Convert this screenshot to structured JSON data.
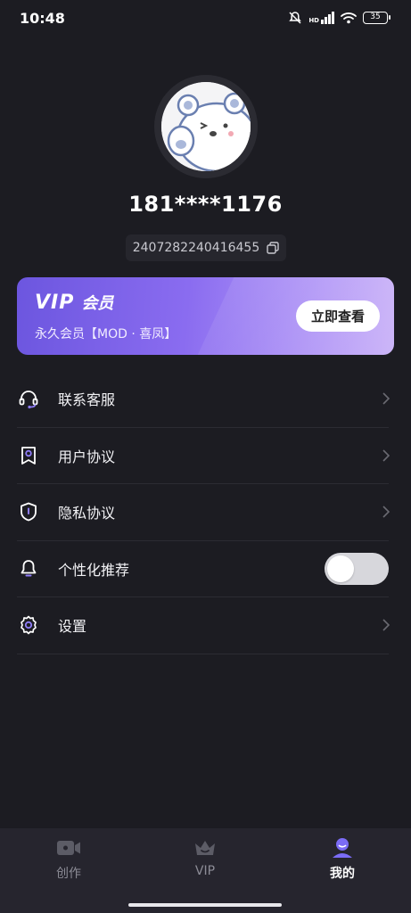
{
  "status_bar": {
    "time": "10:48",
    "network": "HD",
    "battery": "35"
  },
  "profile": {
    "phone": "181****1176",
    "uid": "2407282240416455"
  },
  "vip_card": {
    "logo": "VIP",
    "title": "会员",
    "subtitle": "永久会员【MOD · 喜凤】",
    "button_label": "立即查看"
  },
  "menu": [
    {
      "label": "联系客服",
      "icon": "headset-icon",
      "type": "link"
    },
    {
      "label": "用户协议",
      "icon": "bookmark-user-icon",
      "type": "link"
    },
    {
      "label": "隐私协议",
      "icon": "shield-icon",
      "type": "link"
    },
    {
      "label": "个性化推荐",
      "icon": "bell-icon",
      "type": "toggle",
      "enabled": false
    },
    {
      "label": "设置",
      "icon": "gear-icon",
      "type": "link"
    }
  ],
  "bottom_nav": [
    {
      "label": "创作",
      "icon": "video-camera-icon",
      "active": false
    },
    {
      "label": "VIP",
      "icon": "crown-icon",
      "active": false
    },
    {
      "label": "我的",
      "icon": "profile-icon",
      "active": true
    }
  ],
  "colors": {
    "background": "#1c1c22",
    "vip_gradient_start": "#6c56df",
    "vip_gradient_end": "#cbb4f8",
    "active_accent": "#7b6cf6"
  }
}
